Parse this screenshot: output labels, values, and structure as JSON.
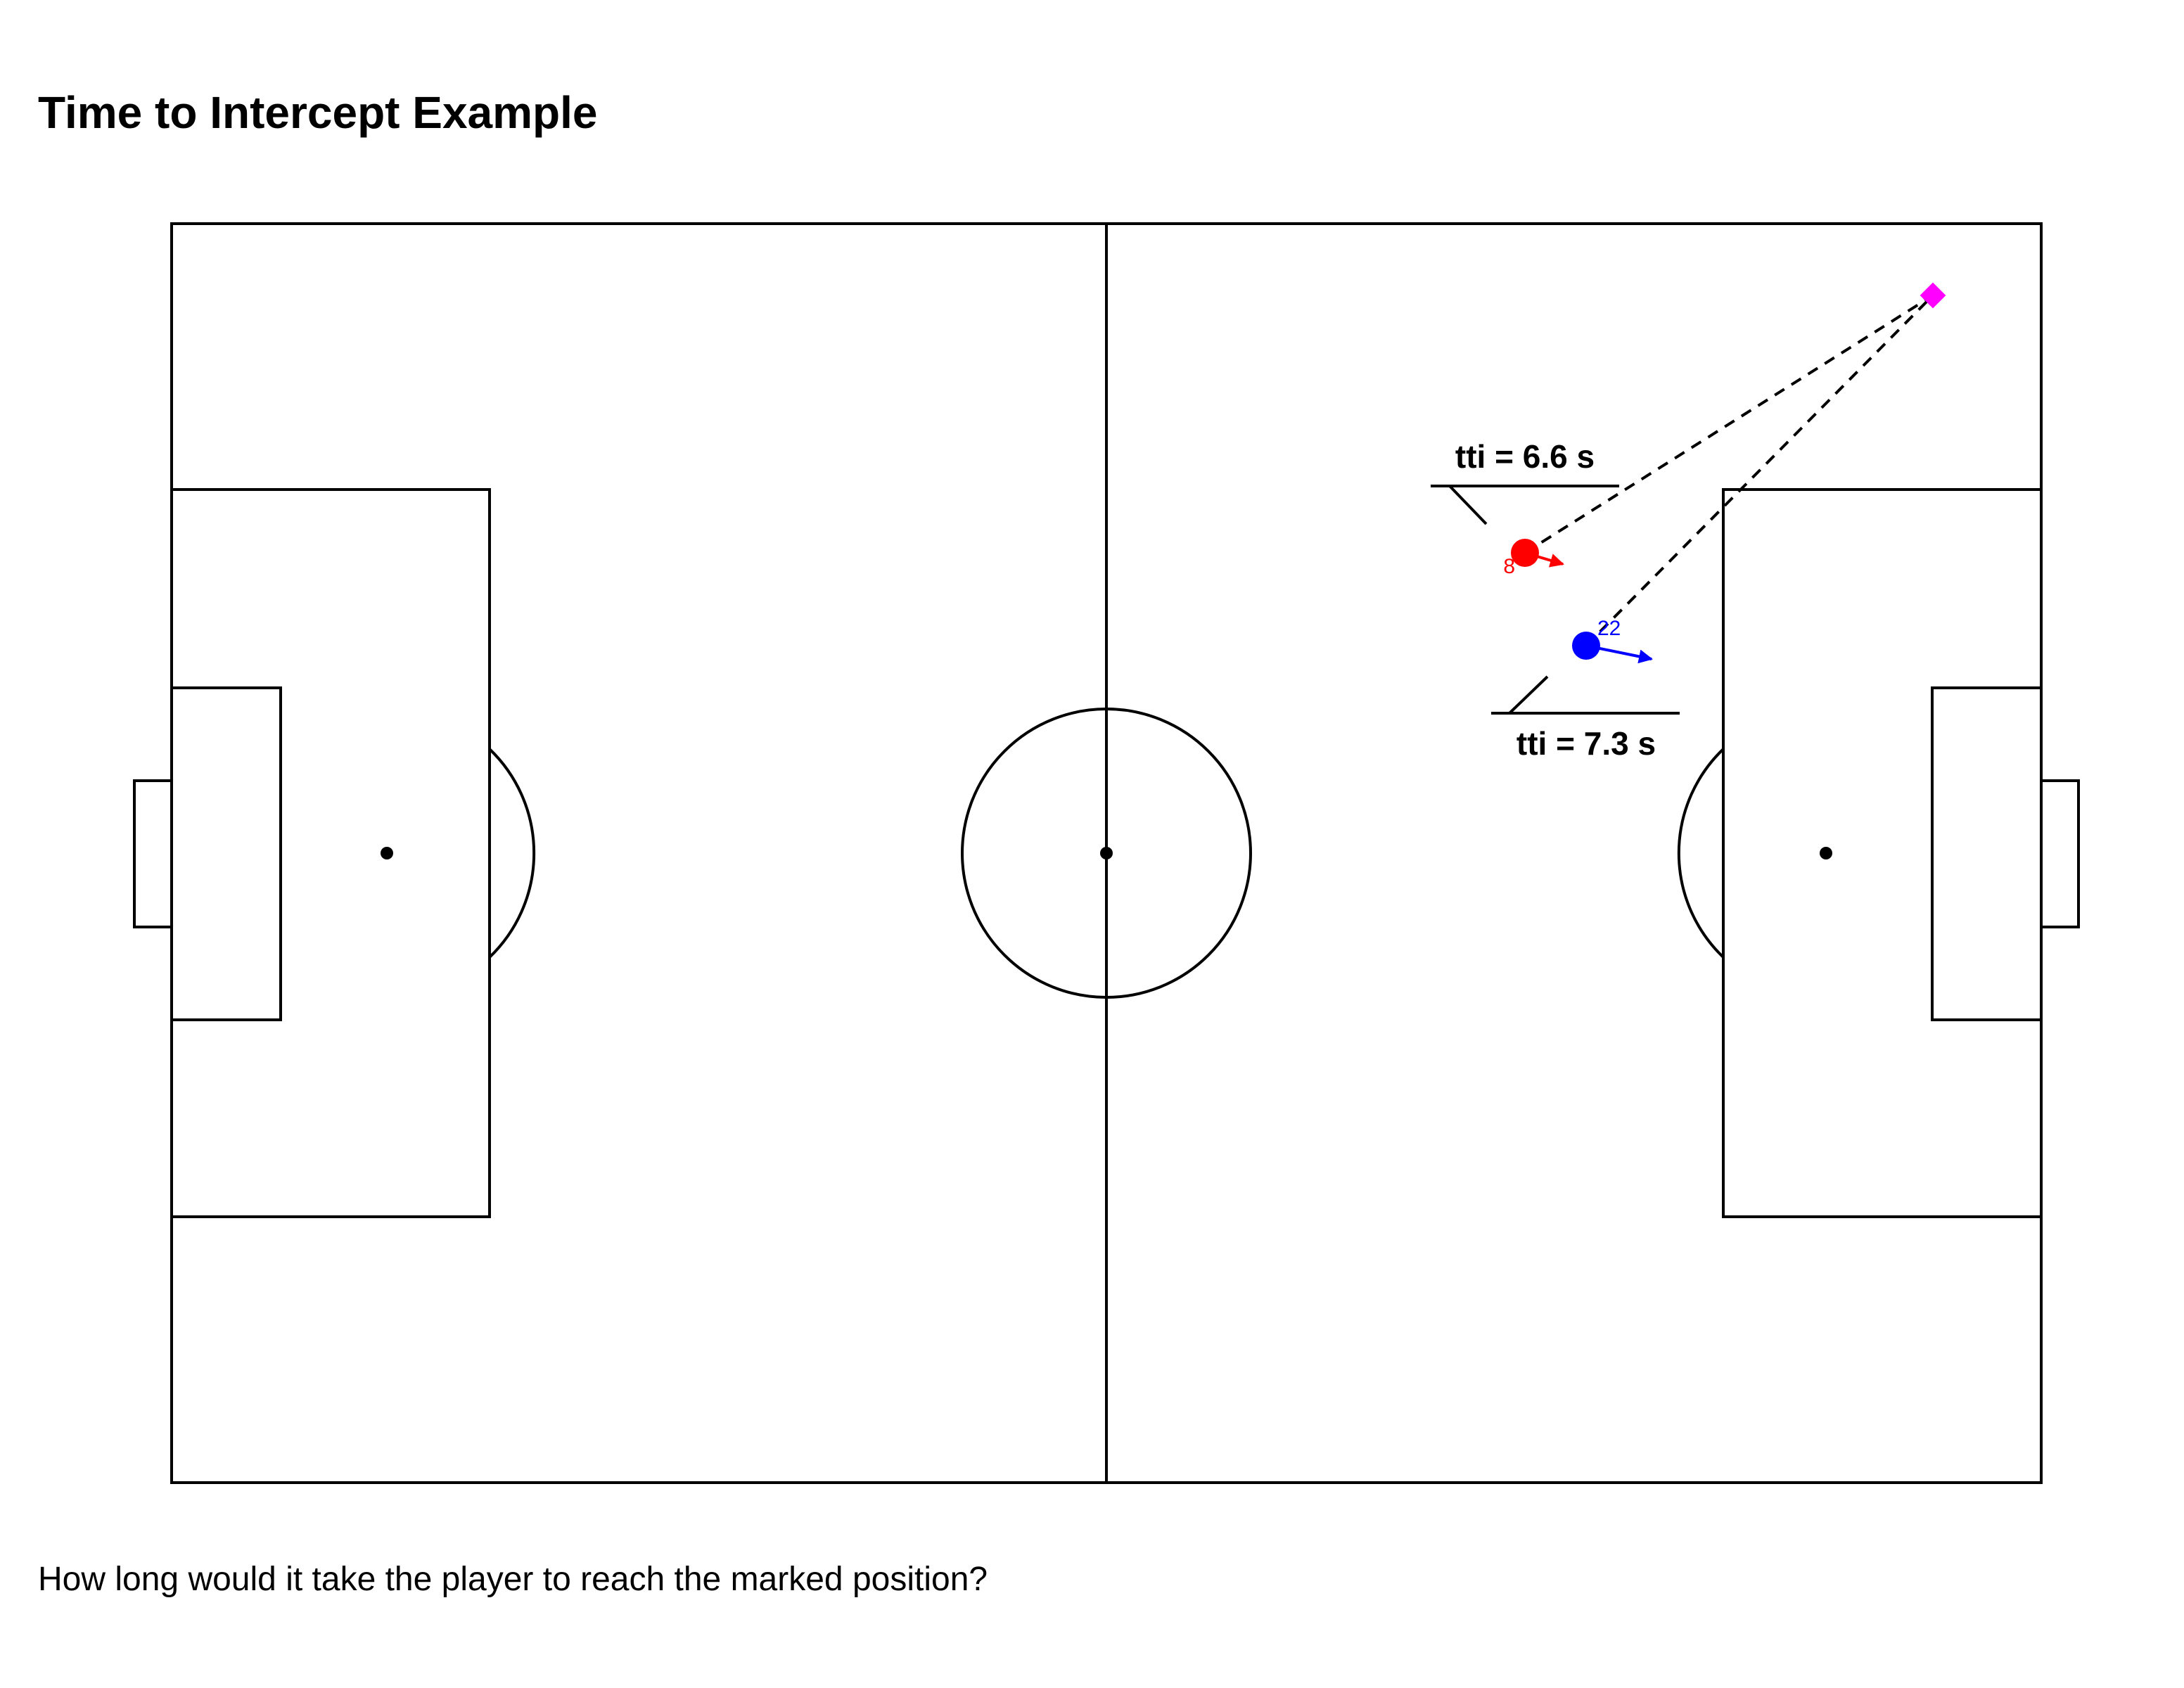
{
  "title": "Time to Intercept Example",
  "caption": "How long would it take the player to reach the marked position?",
  "colors": {
    "lines": "#000000",
    "background": "#ffffff",
    "red_player": "#ff0000",
    "blue_player": "#0000ff",
    "target_marker": "#ff00ff"
  },
  "target": {
    "marker": "diamond",
    "color": "magenta"
  },
  "players": [
    {
      "id": "red",
      "number": "8",
      "color": "#ff0000",
      "tti_label": "tti = 6.6 s",
      "tti_seconds": 6.6
    },
    {
      "id": "blue",
      "number": "22",
      "color": "#0000ff",
      "tti_label": "tti = 7.3 s",
      "tti_seconds": 7.3
    }
  ]
}
